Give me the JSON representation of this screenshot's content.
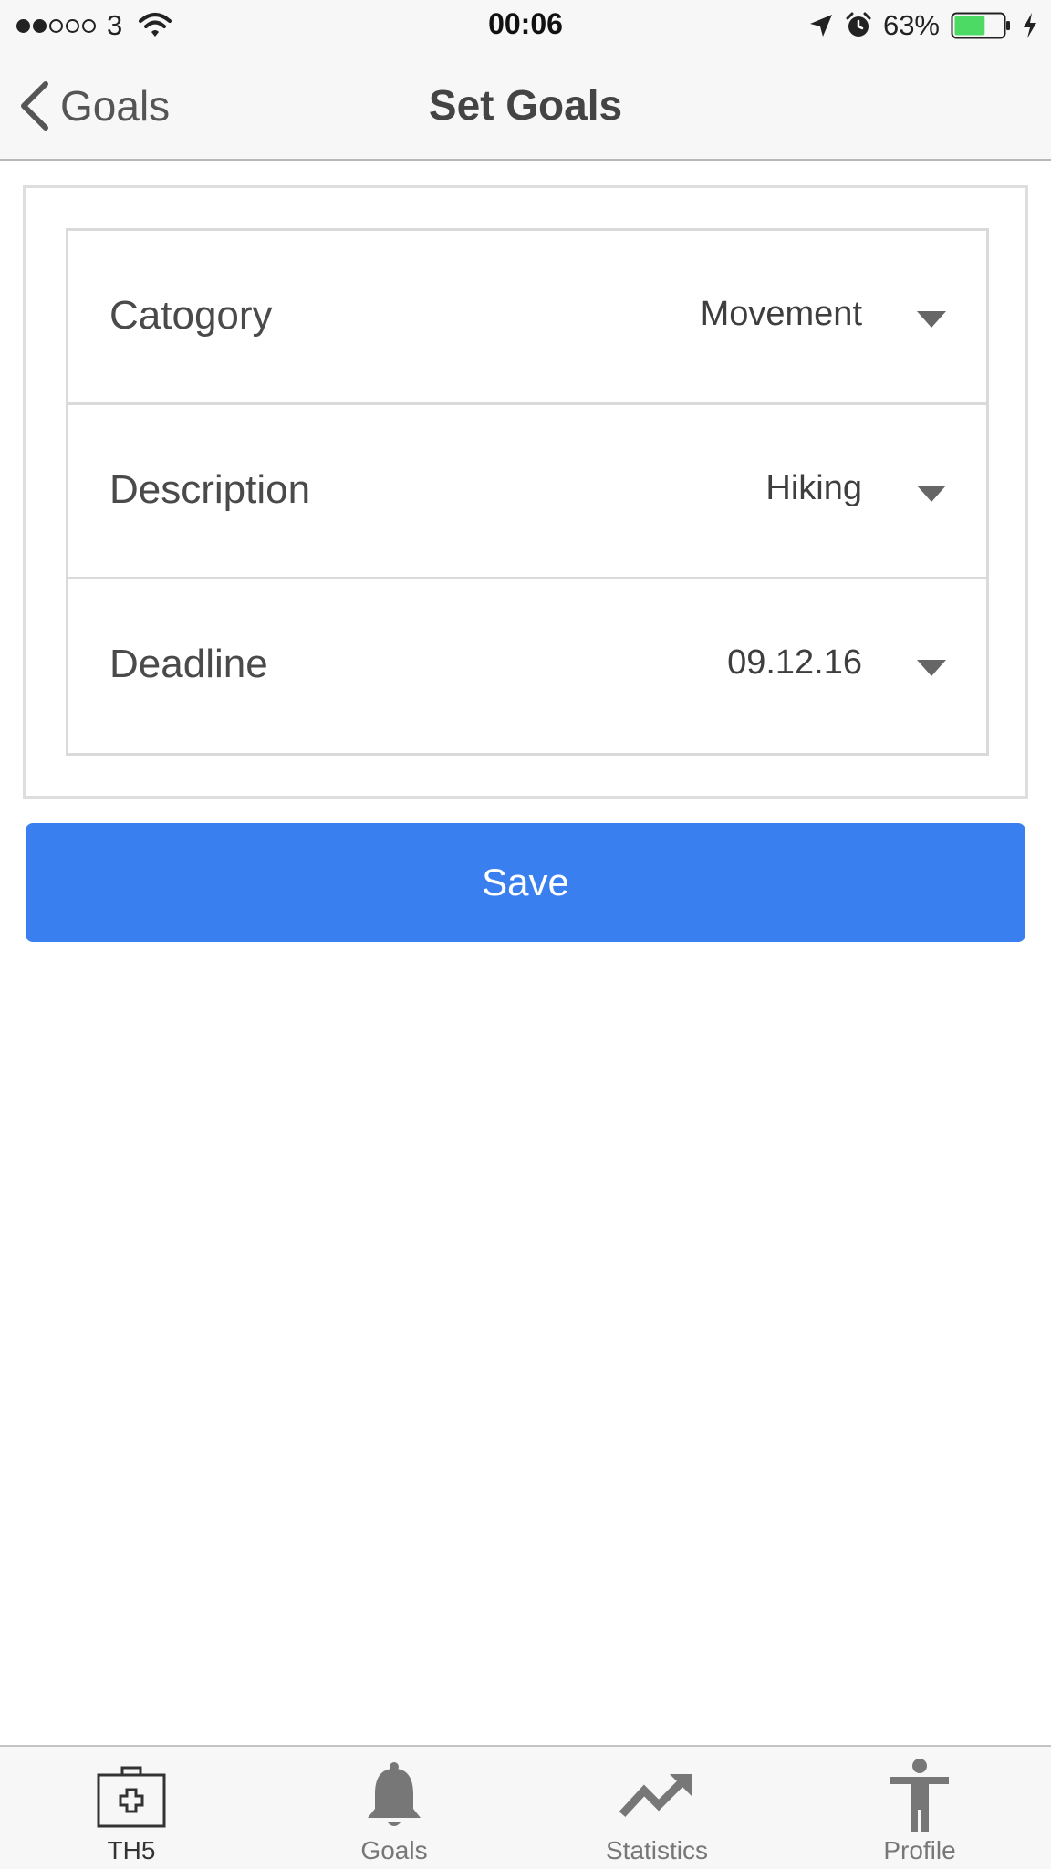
{
  "status_bar": {
    "carrier": "3",
    "time": "00:06",
    "battery_percent": "63%",
    "battery_level": 0.63,
    "battery_color": "#4cd964",
    "icons": [
      "signal-dots",
      "wifi-icon",
      "location-arrow-icon",
      "alarm-icon",
      "battery-icon",
      "charging-bolt-icon"
    ]
  },
  "nav": {
    "back_label": "Goals",
    "title": "Set Goals"
  },
  "form": {
    "rows": [
      {
        "label": "Catogory",
        "value": "Movement"
      },
      {
        "label": "Description",
        "value": "Hiking"
      },
      {
        "label": "Deadline",
        "value": "09.12.16"
      }
    ]
  },
  "save_label": "Save",
  "colors": {
    "accent": "#3a7ff0"
  },
  "tabs": [
    {
      "label": "TH5",
      "icon": "medical-kit-icon",
      "active": true
    },
    {
      "label": "Goals",
      "icon": "bell-icon",
      "active": false
    },
    {
      "label": "Statistics",
      "icon": "trending-up-icon",
      "active": false
    },
    {
      "label": "Profile",
      "icon": "person-icon",
      "active": false
    }
  ]
}
